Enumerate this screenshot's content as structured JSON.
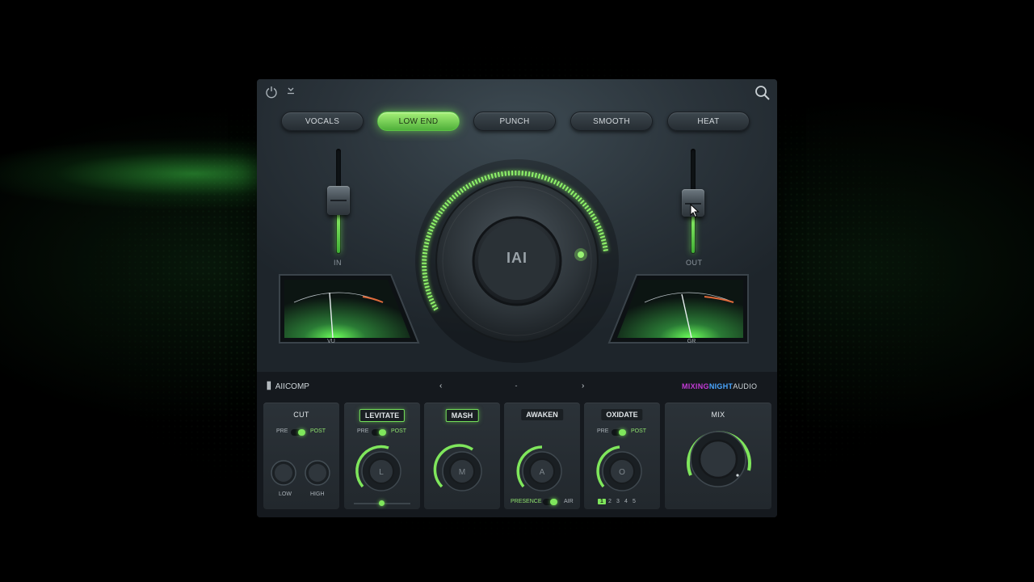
{
  "window": {
    "icons": [
      "power-icon",
      "download-icon",
      "search-icon"
    ]
  },
  "presets": [
    {
      "label": "VOCALS",
      "active": false
    },
    {
      "label": "LOW END",
      "active": true
    },
    {
      "label": "PUNCH",
      "active": false
    },
    {
      "label": "SMOOTH",
      "active": false
    },
    {
      "label": "HEAT",
      "active": false
    }
  ],
  "faders": {
    "in_label": "IN",
    "out_label": "OUT"
  },
  "meters": {
    "left_label": "VU",
    "right_label": "GR"
  },
  "center_logo": "IAI",
  "bottom_bar": {
    "brand": "AIICOMP",
    "preset_name": "-",
    "prev_icon": "chevron-left-icon",
    "next_icon": "chevron-right-icon",
    "vendor_part1": "MIXING",
    "vendor_part2": "NIGHT",
    "vendor_part3": "AUDIO"
  },
  "modules": {
    "cut": {
      "title": "CUT",
      "pre": "PRE",
      "post": "POST",
      "low": "LOW",
      "high": "HIGH"
    },
    "levitate": {
      "title": "LEVITATE",
      "pre": "PRE",
      "post": "POST",
      "knob_letter": "L"
    },
    "mash": {
      "title": "MASH",
      "knob_letter": "M"
    },
    "awaken": {
      "title": "AWAKEN",
      "knob_letter": "A",
      "left": "PRESENCE",
      "right": "AIR"
    },
    "oxidate": {
      "title": "OXIDATE",
      "pre": "PRE",
      "post": "POST",
      "knob_letter": "O",
      "modes": [
        "1",
        "2",
        "3",
        "4",
        "5"
      ],
      "selected_mode": "1"
    },
    "mix": {
      "title": "MIX"
    }
  },
  "colors": {
    "accent": "#7fe65c",
    "panel": "#2a333a",
    "text": "#cfd6da"
  }
}
